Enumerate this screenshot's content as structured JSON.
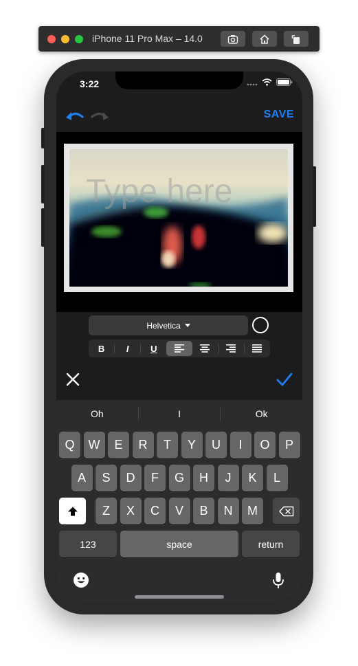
{
  "simulator": {
    "title": "iPhone 11 Pro Max – 14.0",
    "buttons": [
      "screenshot-icon",
      "home-icon",
      "rotate-icon"
    ]
  },
  "status_bar": {
    "time": "3:22"
  },
  "nav": {
    "save_label": "SAVE"
  },
  "canvas": {
    "placeholder_text": "Type here"
  },
  "text_toolbar": {
    "font": "Helvetica",
    "color": "#ffffff",
    "format_buttons": [
      "bold",
      "italic",
      "underline",
      "align-left",
      "align-center",
      "align-right",
      "align-justify"
    ],
    "bold_label": "B",
    "italic_label": "I",
    "underline_label": "U",
    "active_alignment": "align-left"
  },
  "accent_color": "#1e7ff2",
  "keyboard": {
    "suggestions": [
      "Oh",
      "I",
      "Ok"
    ],
    "row1": [
      "Q",
      "W",
      "E",
      "R",
      "T",
      "Y",
      "U",
      "I",
      "O",
      "P"
    ],
    "row2": [
      "A",
      "S",
      "D",
      "F",
      "G",
      "H",
      "J",
      "K",
      "L"
    ],
    "row3": [
      "Z",
      "X",
      "C",
      "V",
      "B",
      "N",
      "M"
    ],
    "numbers_label": "123",
    "space_label": "space",
    "return_label": "return"
  }
}
